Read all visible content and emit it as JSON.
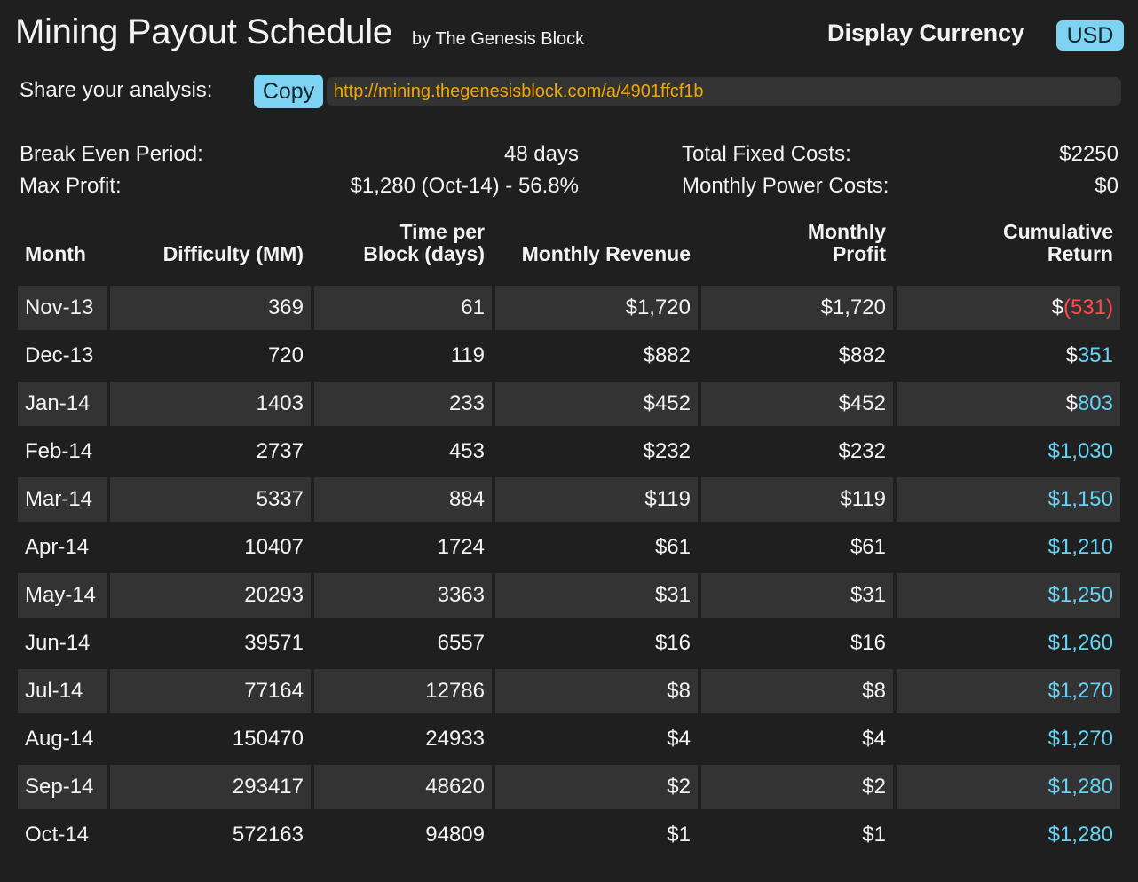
{
  "header": {
    "title": "Mining Payout Schedule",
    "byline": "by The Genesis Block",
    "currency_label": "Display Currency",
    "currency_value": "USD"
  },
  "share": {
    "label": "Share your analysis:",
    "copy_label": "Copy",
    "url": "http://mining.thegenesisblock.com/a/4901ffcf1b"
  },
  "summary": {
    "break_even_label": "Break Even Period:",
    "break_even_value": "48 days",
    "max_profit_label": "Max Profit:",
    "max_profit_value": "$1,280 (Oct-14) - 56.8%",
    "fixed_costs_label": "Total Fixed Costs:",
    "fixed_costs_value": "$2250",
    "power_costs_label": "Monthly Power Costs:",
    "power_costs_value": "$0"
  },
  "table": {
    "columns": {
      "month": "Month",
      "difficulty": "Difficulty (MM)",
      "time_line1": "Time per",
      "time_line2": "Block (days)",
      "revenue": "Monthly Revenue",
      "profit_line1": "Monthly",
      "profit_line2": "Profit",
      "cumulative_line1": "Cumulative",
      "cumulative_line2": "Return"
    },
    "rows": [
      {
        "month": "Nov-13",
        "difficulty": "369",
        "time": "61",
        "revenue": "$1,720",
        "profit": "$1,720",
        "cum_prefix": "$",
        "cum_value": "(531)",
        "cum_status": "negative"
      },
      {
        "month": "Dec-13",
        "difficulty": "720",
        "time": "119",
        "revenue": "$882",
        "profit": "$882",
        "cum_prefix": "$",
        "cum_value": "351",
        "cum_status": "positive"
      },
      {
        "month": "Jan-14",
        "difficulty": "1403",
        "time": "233",
        "revenue": "$452",
        "profit": "$452",
        "cum_prefix": "$",
        "cum_value": "803",
        "cum_status": "positive"
      },
      {
        "month": "Feb-14",
        "difficulty": "2737",
        "time": "453",
        "revenue": "$232",
        "profit": "$232",
        "cum_prefix": "",
        "cum_value": "$1,030",
        "cum_status": "positive"
      },
      {
        "month": "Mar-14",
        "difficulty": "5337",
        "time": "884",
        "revenue": "$119",
        "profit": "$119",
        "cum_prefix": "",
        "cum_value": "$1,150",
        "cum_status": "positive"
      },
      {
        "month": "Apr-14",
        "difficulty": "10407",
        "time": "1724",
        "revenue": "$61",
        "profit": "$61",
        "cum_prefix": "",
        "cum_value": "$1,210",
        "cum_status": "positive"
      },
      {
        "month": "May-14",
        "difficulty": "20293",
        "time": "3363",
        "revenue": "$31",
        "profit": "$31",
        "cum_prefix": "",
        "cum_value": "$1,250",
        "cum_status": "positive"
      },
      {
        "month": "Jun-14",
        "difficulty": "39571",
        "time": "6557",
        "revenue": "$16",
        "profit": "$16",
        "cum_prefix": "",
        "cum_value": "$1,260",
        "cum_status": "positive"
      },
      {
        "month": "Jul-14",
        "difficulty": "77164",
        "time": "12786",
        "revenue": "$8",
        "profit": "$8",
        "cum_prefix": "",
        "cum_value": "$1,270",
        "cum_status": "positive"
      },
      {
        "month": "Aug-14",
        "difficulty": "150470",
        "time": "24933",
        "revenue": "$4",
        "profit": "$4",
        "cum_prefix": "",
        "cum_value": "$1,270",
        "cum_status": "positive"
      },
      {
        "month": "Sep-14",
        "difficulty": "293417",
        "time": "48620",
        "revenue": "$2",
        "profit": "$2",
        "cum_prefix": "",
        "cum_value": "$1,280",
        "cum_status": "positive"
      },
      {
        "month": "Oct-14",
        "difficulty": "572163",
        "time": "94809",
        "revenue": "$1",
        "profit": "$1",
        "cum_prefix": "",
        "cum_value": "$1,280",
        "cum_status": "positive"
      }
    ]
  },
  "colors": {
    "background": "#1f1f1f",
    "row_shade": "#333333",
    "button": "#7fd3f2",
    "link": "#f0a800",
    "negative": "#ff4a4a",
    "positive": "#66d3f4"
  }
}
